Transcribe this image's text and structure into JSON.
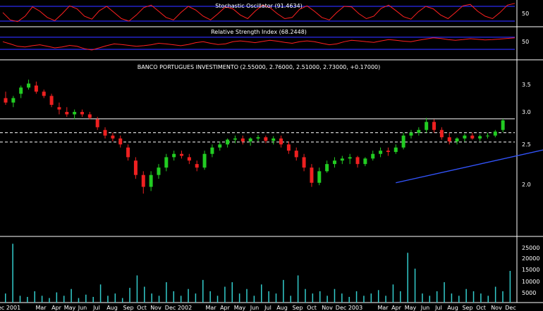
{
  "colors": {
    "background": "#000000",
    "grid_blue": "#2a2af0",
    "oscillator_line": "#ff2020",
    "candle_up": "#22cc22",
    "candle_down": "#ee2020",
    "trendline": "#3355ff",
    "volume": "#33cccc",
    "divider": "#ffffff"
  },
  "chart_data": [
    {
      "type": "line",
      "title": "Stochastic Oscillator (91.4634)",
      "ylim": [
        0,
        100
      ],
      "y_ticks": [
        "50"
      ],
      "bands": [
        20,
        80
      ],
      "series": [
        {
          "name": "",
          "values": [
            55,
            25,
            18,
            40,
            78,
            60,
            35,
            22,
            50,
            82,
            70,
            40,
            28,
            62,
            80,
            55,
            30,
            20,
            45,
            75,
            85,
            60,
            35,
            25,
            55,
            80,
            65,
            40,
            25,
            50,
            78,
            70,
            45,
            30,
            60,
            85,
            75,
            50,
            30,
            35,
            68,
            82,
            60,
            35,
            25,
            55,
            80,
            78,
            50,
            30,
            40,
            72,
            85,
            62,
            38,
            28,
            58,
            80,
            70,
            45,
            30,
            55,
            82,
            88,
            60,
            40,
            30,
            55,
            85,
            92
          ]
        }
      ]
    },
    {
      "type": "line",
      "title": "Relative Strength Index (68.2448)",
      "ylim": [
        0,
        100
      ],
      "y_ticks": [
        "50"
      ],
      "bands": [
        30,
        70
      ],
      "series": [
        {
          "name": "",
          "values": [
            55,
            48,
            40,
            38,
            42,
            45,
            40,
            35,
            38,
            43,
            40,
            32,
            28,
            35,
            42,
            48,
            46,
            43,
            40,
            42,
            45,
            50,
            48,
            45,
            42,
            46,
            52,
            55,
            50,
            46,
            48,
            55,
            58,
            55,
            52,
            56,
            60,
            57,
            53,
            50,
            55,
            58,
            55,
            50,
            45,
            48,
            55,
            60,
            58,
            55,
            53,
            58,
            62,
            60,
            57,
            55,
            60,
            64,
            68,
            66,
            62,
            60,
            62,
            65,
            63,
            61,
            62,
            64,
            66,
            68
          ]
        }
      ]
    },
    {
      "type": "candlestick",
      "title": "BANCO PORTUGUES INVESTIMENTO (2.55000, 2.76000, 2.51000, 2.73000, +0.17000)",
      "y_ticks": [
        "3.5",
        "3.0",
        "2.5",
        "2.0"
      ],
      "y_scale": "log",
      "ylim": [
        1.2,
        4.1
      ],
      "resistance_level": 2.76,
      "support_levels": [
        2.5,
        2.34
      ],
      "trendline": {
        "from": [
          51,
          1.75
        ],
        "to": [
          78,
          2.43
        ]
      },
      "candles": [
        [
          3.2,
          3.35,
          3.05,
          3.1
        ],
        [
          3.1,
          3.25,
          3.0,
          3.2
        ],
        [
          3.3,
          3.5,
          3.2,
          3.45
        ],
        [
          3.45,
          3.65,
          3.4,
          3.55
        ],
        [
          3.5,
          3.6,
          3.3,
          3.35
        ],
        [
          3.35,
          3.4,
          3.2,
          3.25
        ],
        [
          3.25,
          3.3,
          3.0,
          3.05
        ],
        [
          3.0,
          3.1,
          2.85,
          2.95
        ],
        [
          2.9,
          3.0,
          2.8,
          2.85
        ],
        [
          2.85,
          2.95,
          2.75,
          2.9
        ],
        [
          2.9,
          2.95,
          2.8,
          2.85
        ],
        [
          2.85,
          2.9,
          2.75,
          2.78
        ],
        [
          2.75,
          2.8,
          2.55,
          2.6
        ],
        [
          2.55,
          2.6,
          2.4,
          2.45
        ],
        [
          2.45,
          2.5,
          2.35,
          2.4
        ],
        [
          2.4,
          2.45,
          2.25,
          2.3
        ],
        [
          2.25,
          2.3,
          2.05,
          2.1
        ],
        [
          2.05,
          2.1,
          1.8,
          1.85
        ],
        [
          1.85,
          1.9,
          1.62,
          1.7
        ],
        [
          1.7,
          1.9,
          1.65,
          1.85
        ],
        [
          1.85,
          2.0,
          1.8,
          1.95
        ],
        [
          1.95,
          2.15,
          1.9,
          2.1
        ],
        [
          2.1,
          2.2,
          2.05,
          2.15
        ],
        [
          2.15,
          2.2,
          2.08,
          2.12
        ],
        [
          2.1,
          2.15,
          2.0,
          2.05
        ],
        [
          2.0,
          2.05,
          1.9,
          1.95
        ],
        [
          1.95,
          2.2,
          1.92,
          2.15
        ],
        [
          2.15,
          2.3,
          2.1,
          2.25
        ],
        [
          2.25,
          2.35,
          2.2,
          2.3
        ],
        [
          2.3,
          2.4,
          2.25,
          2.38
        ],
        [
          2.38,
          2.45,
          2.32,
          2.4
        ],
        [
          2.4,
          2.45,
          2.3,
          2.35
        ],
        [
          2.35,
          2.42,
          2.28,
          2.4
        ],
        [
          2.4,
          2.46,
          2.35,
          2.42
        ],
        [
          2.42,
          2.45,
          2.32,
          2.36
        ],
        [
          2.36,
          2.44,
          2.3,
          2.4
        ],
        [
          2.4,
          2.45,
          2.25,
          2.3
        ],
        [
          2.3,
          2.35,
          2.15,
          2.2
        ],
        [
          2.2,
          2.25,
          2.05,
          2.1
        ],
        [
          2.1,
          2.15,
          1.9,
          1.95
        ],
        [
          1.95,
          2.0,
          1.7,
          1.75
        ],
        [
          1.75,
          1.95,
          1.72,
          1.9
        ],
        [
          1.9,
          2.05,
          1.88,
          2.0
        ],
        [
          2.0,
          2.1,
          1.95,
          2.05
        ],
        [
          2.05,
          2.12,
          2.0,
          2.08
        ],
        [
          2.08,
          2.15,
          2.0,
          2.1
        ],
        [
          2.1,
          2.12,
          1.95,
          2.0
        ],
        [
          2.0,
          2.1,
          1.97,
          2.08
        ],
        [
          2.08,
          2.2,
          2.05,
          2.15
        ],
        [
          2.15,
          2.25,
          2.1,
          2.2
        ],
        [
          2.2,
          2.25,
          2.12,
          2.18
        ],
        [
          2.18,
          2.3,
          2.15,
          2.25
        ],
        [
          2.25,
          2.5,
          2.22,
          2.45
        ],
        [
          2.45,
          2.55,
          2.4,
          2.5
        ],
        [
          2.5,
          2.6,
          2.45,
          2.55
        ],
        [
          2.55,
          2.78,
          2.5,
          2.7
        ],
        [
          2.7,
          2.75,
          2.5,
          2.55
        ],
        [
          2.55,
          2.6,
          2.38,
          2.42
        ],
        [
          2.42,
          2.5,
          2.3,
          2.35
        ],
        [
          2.35,
          2.42,
          2.3,
          2.4
        ],
        [
          2.4,
          2.48,
          2.35,
          2.45
        ],
        [
          2.45,
          2.5,
          2.38,
          2.4
        ],
        [
          2.4,
          2.47,
          2.36,
          2.44
        ],
        [
          2.44,
          2.5,
          2.4,
          2.45
        ],
        [
          2.45,
          2.55,
          2.42,
          2.52
        ],
        [
          2.55,
          2.76,
          2.51,
          2.73
        ]
      ]
    },
    {
      "type": "bar",
      "title": "",
      "y_ticks": [
        "25000",
        "20000",
        "15000",
        "10000",
        "5000"
      ],
      "ylim": [
        0,
        28000
      ],
      "values": [
        4000,
        26000,
        3000,
        2500,
        5000,
        3000,
        2000,
        4500,
        3000,
        6000,
        2000,
        3500,
        2500,
        8000,
        3000,
        4000,
        2000,
        6500,
        12000,
        7000,
        4000,
        3000,
        9000,
        5000,
        3000,
        6000,
        4000,
        10000,
        5000,
        3000,
        7000,
        9000,
        4000,
        6000,
        3000,
        8000,
        5000,
        4000,
        10000,
        3000,
        12000,
        6000,
        4000,
        5000,
        3000,
        6000,
        4000,
        2500,
        5000,
        3000,
        4000,
        5500,
        3000,
        8000,
        5000,
        22000,
        15000,
        4000,
        3000,
        5000,
        9000,
        4000,
        3000,
        6000,
        5000,
        4000,
        3000,
        7000,
        5000,
        14000
      ]
    }
  ],
  "x_axis": {
    "labels": [
      "Dec 2001",
      "Mar",
      "Apr",
      "May",
      "Jun",
      "Jul",
      "Aug",
      "Sep",
      "Oct",
      "Nov",
      "Dec 2002",
      "Mar",
      "Apr",
      "May",
      "Jun",
      "Jul",
      "Aug",
      "Sep",
      "Oct",
      "Nov",
      "Dec 2003",
      "Mar",
      "Apr",
      "May",
      "Jun",
      "Jul",
      "Aug",
      "Sep",
      "Oct",
      "Nov",
      "Dec"
    ]
  }
}
